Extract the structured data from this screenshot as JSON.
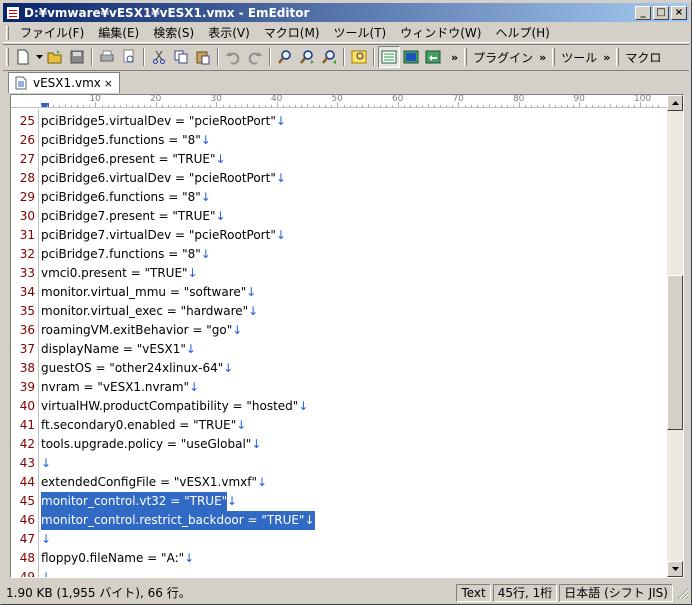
{
  "window": {
    "title": "D:¥vmware¥vESX1¥vESX1.vmx - EmEditor",
    "min_label": "_",
    "max_label": "□",
    "close_label": "×"
  },
  "menu": {
    "items": [
      {
        "label": "ファイル(F)"
      },
      {
        "label": "編集(E)"
      },
      {
        "label": "検索(S)"
      },
      {
        "label": "表示(V)"
      },
      {
        "label": "マクロ(M)"
      },
      {
        "label": "ツール(T)"
      },
      {
        "label": "ウィンドウ(W)"
      },
      {
        "label": "ヘルプ(H)"
      }
    ]
  },
  "toolbar": {
    "overflow_label": "»",
    "plugins_label": "プラグイン",
    "tools_label": "ツール",
    "macro_label": "マクロ",
    "icons": [
      "new-file-icon",
      "open-icon",
      "save-icon",
      "print-icon",
      "print-preview-icon",
      "cut-icon",
      "copy-icon",
      "paste-icon",
      "undo-icon",
      "redo-icon",
      "find-icon",
      "find-next-icon",
      "find-prev-icon",
      "highlight-icon",
      "view-icon-1",
      "view-icon-2",
      "view-icon-3"
    ]
  },
  "tab": {
    "label": "vESX1.vmx",
    "close_label": "×"
  },
  "ruler": {
    "labels": [
      "10",
      "20",
      "30",
      "40",
      "50",
      "60",
      "70",
      "80",
      "90",
      "100"
    ]
  },
  "editor": {
    "eol_mark": "↓",
    "lines": [
      {
        "num": "25",
        "text": "pciBridge5.virtualDev = \"pcieRootPort\"",
        "selected": false
      },
      {
        "num": "26",
        "text": "pciBridge5.functions = \"8\"",
        "selected": false
      },
      {
        "num": "27",
        "text": "pciBridge6.present = \"TRUE\"",
        "selected": false
      },
      {
        "num": "28",
        "text": "pciBridge6.virtualDev = \"pcieRootPort\"",
        "selected": false
      },
      {
        "num": "29",
        "text": "pciBridge6.functions = \"8\"",
        "selected": false
      },
      {
        "num": "30",
        "text": "pciBridge7.present = \"TRUE\"",
        "selected": false
      },
      {
        "num": "31",
        "text": "pciBridge7.virtualDev = \"pcieRootPort\"",
        "selected": false
      },
      {
        "num": "32",
        "text": "pciBridge7.functions = \"8\"",
        "selected": false
      },
      {
        "num": "33",
        "text": "vmci0.present = \"TRUE\"",
        "selected": false
      },
      {
        "num": "34",
        "text": "monitor.virtual_mmu = \"software\"",
        "selected": false
      },
      {
        "num": "35",
        "text": "monitor.virtual_exec = \"hardware\"",
        "selected": false
      },
      {
        "num": "36",
        "text": "roamingVM.exitBehavior = \"go\"",
        "selected": false
      },
      {
        "num": "37",
        "text": "displayName = \"vESX1\"",
        "selected": false
      },
      {
        "num": "38",
        "text": "guestOS = \"other24xlinux-64\"",
        "selected": false
      },
      {
        "num": "39",
        "text": "nvram = \"vESX1.nvram\"",
        "selected": false
      },
      {
        "num": "40",
        "text": "virtualHW.productCompatibility = \"hosted\"",
        "selected": false
      },
      {
        "num": "41",
        "text": "ft.secondary0.enabled = \"TRUE\"",
        "selected": false
      },
      {
        "num": "42",
        "text": "tools.upgrade.policy = \"useGlobal\"",
        "selected": false
      },
      {
        "num": "43",
        "text": "",
        "selected": false
      },
      {
        "num": "44",
        "text": "extendedConfigFile = \"vESX1.vmxf\"",
        "selected": false
      },
      {
        "num": "45",
        "text": "monitor_control.vt32 = \"TRUE\"",
        "selected": true,
        "eol_selected": false
      },
      {
        "num": "46",
        "text": "monitor_control.restrict_backdoor = \"TRUE\"",
        "selected": true,
        "eol_selected": true
      },
      {
        "num": "47",
        "text": "",
        "selected": false
      },
      {
        "num": "48",
        "text": "floppy0.fileName = \"A:\"",
        "selected": false
      },
      {
        "num": "49",
        "text": "",
        "selected": false
      }
    ]
  },
  "status": {
    "summary": "1.90 KB (1,955 バイト), 66 行。",
    "mode": "Text",
    "position": "45行, 1桁",
    "encoding": "日本語 (シフト JIS)"
  },
  "colors": {
    "selection": "#316ac5",
    "line_number": "#800000",
    "eol_mark": "#2060e0",
    "title_gradient_start": "#0a246a",
    "title_gradient_end": "#a6caf0"
  }
}
